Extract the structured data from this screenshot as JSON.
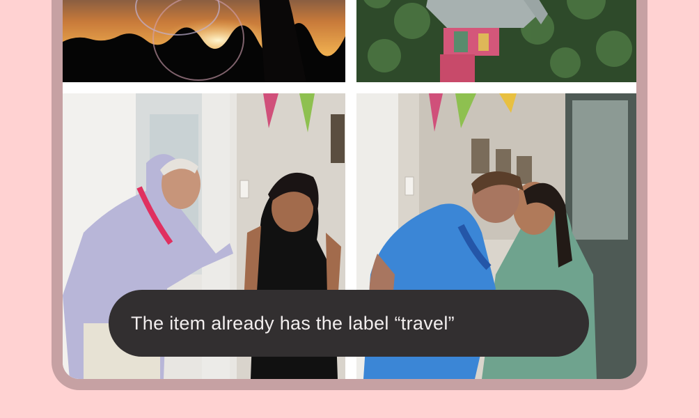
{
  "photos": [
    {
      "name": "photo-bubble-sunset"
    },
    {
      "name": "photo-person-hedge"
    },
    {
      "name": "photo-party-man-woman"
    },
    {
      "name": "photo-women-kiss"
    }
  ],
  "snackbar": {
    "message": "The item already has the label “travel”"
  },
  "colors": {
    "background": "#ffd2d2",
    "device_frame": "#c6a1a3",
    "snackbar_bg": "#322f30",
    "snackbar_text": "#f2eeee"
  }
}
